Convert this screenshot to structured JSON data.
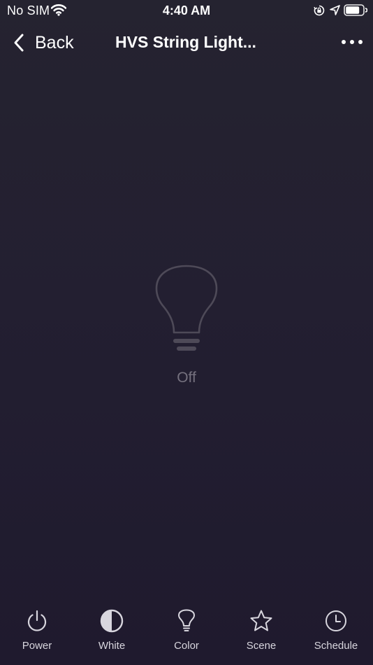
{
  "status_bar": {
    "carrier": "No SIM",
    "time": "4:40 AM"
  },
  "nav": {
    "back_label": "Back",
    "title": "HVS String Light..."
  },
  "device": {
    "state": "Off"
  },
  "tabs": [
    {
      "label": "Power",
      "icon": "power-icon"
    },
    {
      "label": "White",
      "icon": "half-circle-icon"
    },
    {
      "label": "Color",
      "icon": "bulb-icon"
    },
    {
      "label": "Scene",
      "icon": "star-icon"
    },
    {
      "label": "Schedule",
      "icon": "clock-icon"
    }
  ],
  "colors": {
    "background": "#231f31",
    "icon": "#d8d6de",
    "bulb_outline": "#4e4a58",
    "state_text": "#75717e"
  }
}
